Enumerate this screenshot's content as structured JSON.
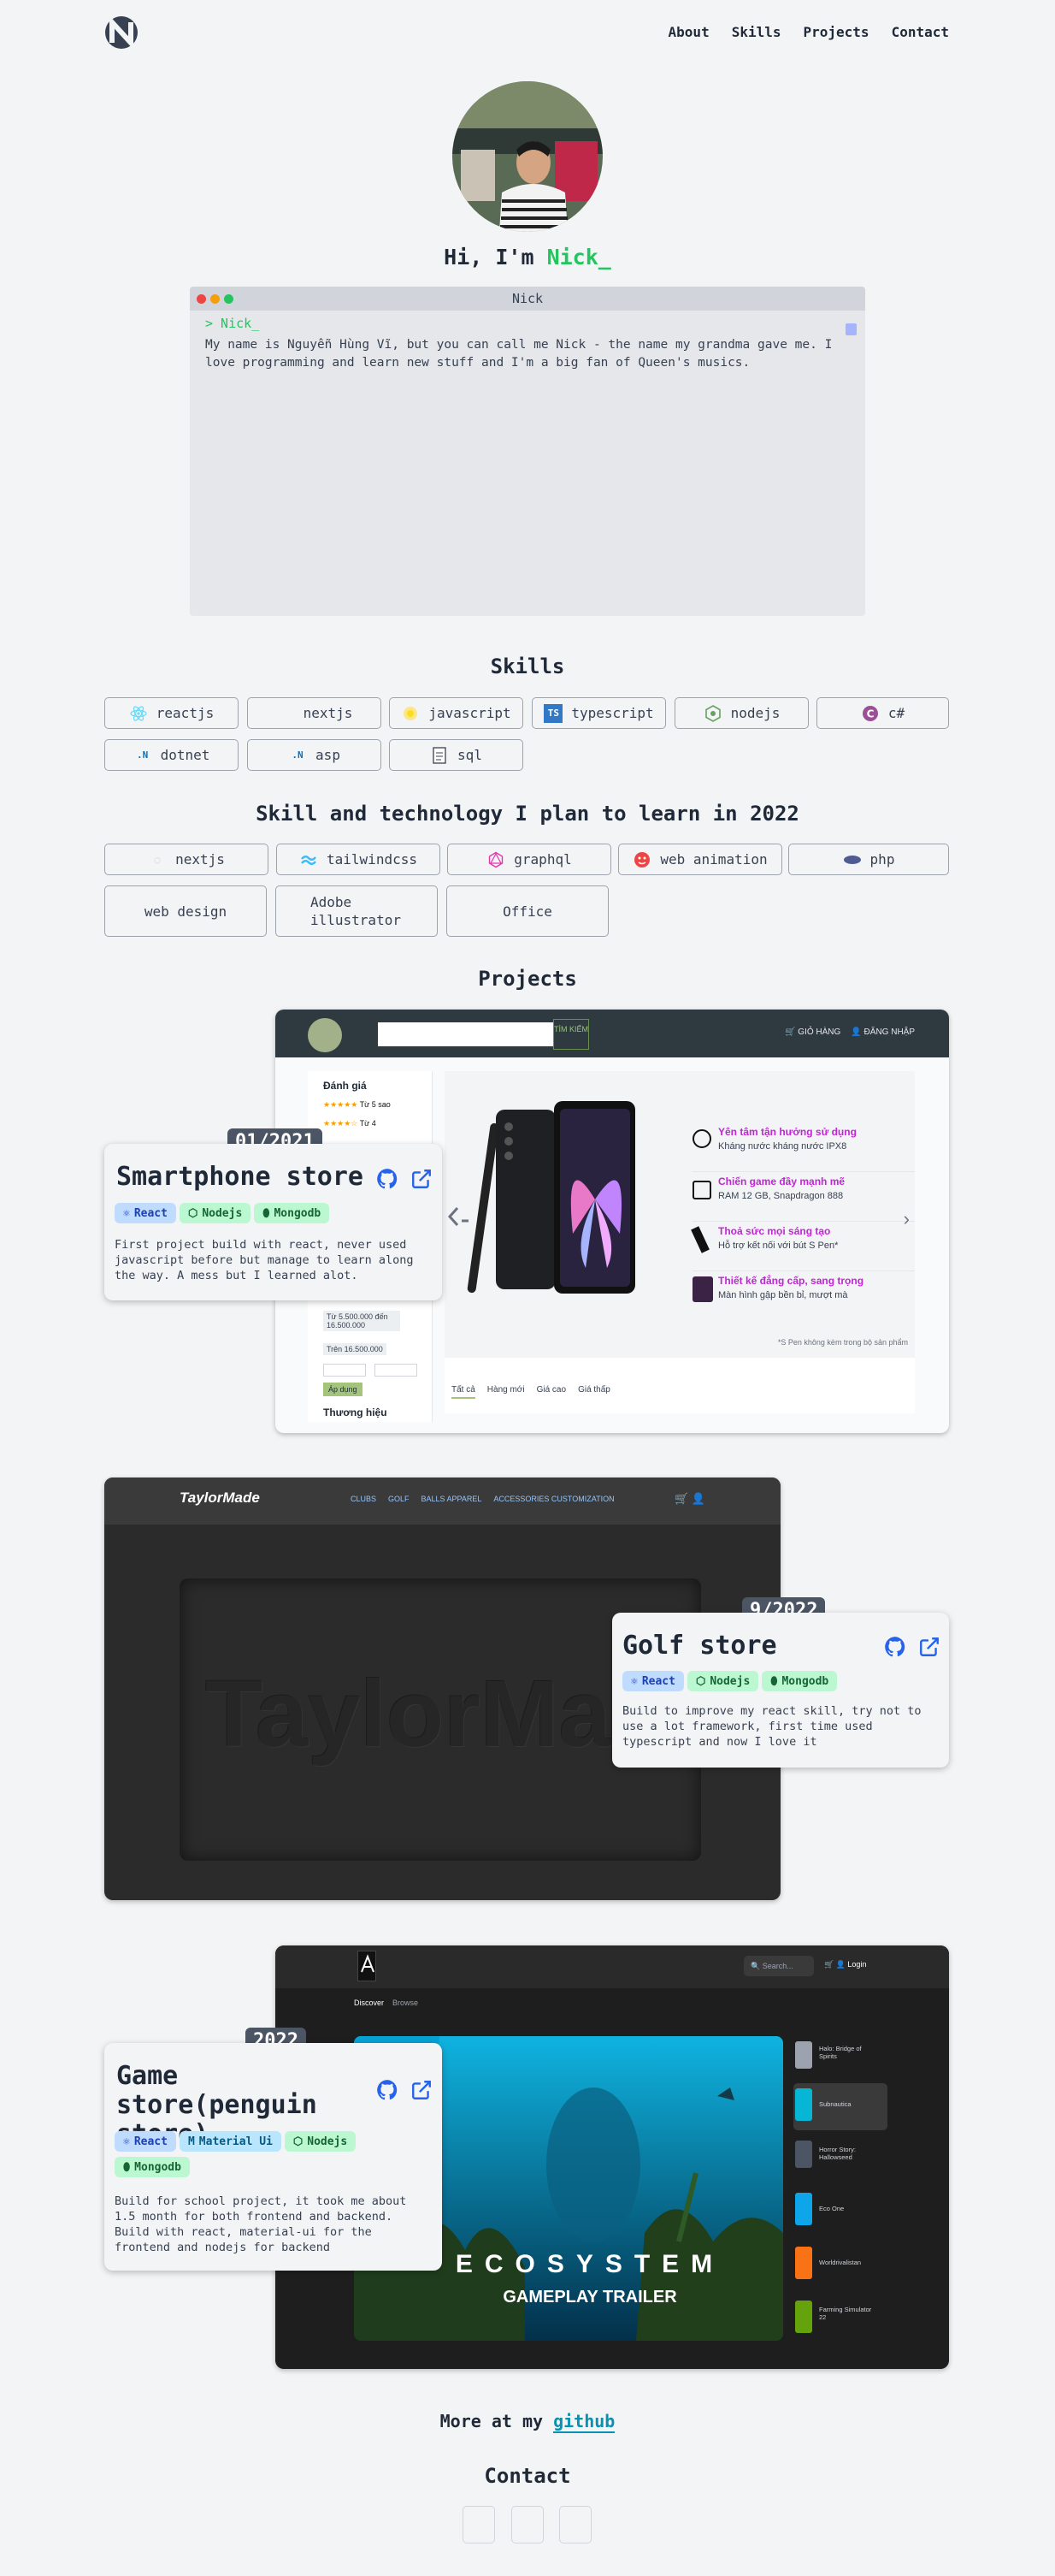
{
  "nav": {
    "links": [
      "About",
      "Skills",
      "Projects",
      "Contact"
    ]
  },
  "hero": {
    "greeting": "Hi, I'm ",
    "name": "Nick_"
  },
  "terminal": {
    "title": "Nick",
    "prompt": "> Nick_",
    "text": "My name is Nguyễn Hùng Vĩ, but you can call me Nick - the name my grandma gave me. I love programming and learn new stuff and I'm a big fan of Queen's musics."
  },
  "skills": {
    "heading": "Skills",
    "items": [
      {
        "label": "reactjs",
        "icon": "react-icon",
        "color": "#61dafb"
      },
      {
        "label": "nextjs",
        "icon": "nextjs-icon",
        "color": "#111111"
      },
      {
        "label": "javascript",
        "icon": "javascript-icon",
        "color": "#f7df1e"
      },
      {
        "label": "typescript",
        "icon": "typescript-icon",
        "color": "#3178c6"
      },
      {
        "label": "nodejs",
        "icon": "nodejs-icon",
        "color": "#68a063"
      },
      {
        "label": "c#",
        "icon": "csharp-icon",
        "color": "#9b4f96"
      },
      {
        "label": "dotnet",
        "icon": "dotnet-icon",
        "color": "#0074c8"
      },
      {
        "label": "asp",
        "icon": "asp-icon",
        "color": "#0074c8"
      },
      {
        "label": "sql",
        "icon": "sql-icon",
        "color": "#374151"
      }
    ]
  },
  "plan": {
    "heading": "Skill and technology I plan to learn in 2022",
    "items": [
      {
        "label": "nextjs",
        "icon": "nextjs-icon"
      },
      {
        "label": "tailwindcss",
        "icon": "tailwind-icon"
      },
      {
        "label": "graphql",
        "icon": "graphql-icon"
      },
      {
        "label": "web animation",
        "icon": "animation-icon"
      },
      {
        "label": "php",
        "icon": "php-icon"
      },
      {
        "label": "web design",
        "icon": ""
      },
      {
        "label": "Adobe illustrator",
        "icon": ""
      },
      {
        "label": "Office",
        "icon": ""
      }
    ]
  },
  "projects": {
    "heading": "Projects",
    "items": [
      {
        "date": "01/2021",
        "title": "Smartphone store",
        "badges": [
          "React",
          "Nodejs",
          "Mongodb"
        ],
        "description": "First project build with react, never used javascript before but manage to learn along the way. A mess but I learned alot.",
        "shot": {
          "search_button": "TÌM KIẾM",
          "cart": "GIỎ HÀNG",
          "login": "ĐĂNG NHẬP",
          "filter_title": "Đánh giá",
          "rating_1": "Từ 5 sao",
          "rating_2": "Từ 4",
          "price_1": "Từ 5.500.000 đến 16.500.000",
          "price_2": "Trên 16.500.000",
          "apply": "Áp dụng",
          "brand": "Thương hiệu",
          "features": [
            {
              "title": "Yên tâm tận hưởng sử dụng",
              "sub": "Kháng nước kháng nước IPX8"
            },
            {
              "title": "Chiến game đầy mạnh mẽ",
              "sub": "RAM 12 GB, Snapdragon 888"
            },
            {
              "title": "Thoả sức mọi sáng tạo",
              "sub": "Hỗ trợ kết nối với bút S Pen*"
            },
            {
              "title": "Thiết kế đẳng cấp, sang trọng",
              "sub": "Màn hình gập bền bỉ, mượt mà"
            }
          ],
          "note": "*S Pen không kèm trong bộ sản phẩm",
          "tabs": [
            "Tất cả",
            "Hàng mới",
            "Giá cao",
            "Giá thấp"
          ]
        }
      },
      {
        "date": "9/2022",
        "title": "Golf store",
        "badges": [
          "React",
          "Nodejs",
          "Mongodb"
        ],
        "description": "Build to improve my react skill, try not to use a lot framework, first time used typescript and now I love it",
        "shot": {
          "brand": "TaylorMade",
          "menu": [
            "CLUBS",
            "GOLF",
            "BALLS APPAREL",
            "ACCESSORIES CUSTOMIZATION"
          ],
          "watermark": "TaylorMade"
        }
      },
      {
        "date": "2022",
        "title": "Game store(penguin store)",
        "badges": [
          "React",
          "Material Ui",
          "Nodejs",
          "Mongodb"
        ],
        "description": "Build for school project, it took me about 1.5 month for both frontend and backend. Build with react, material-ui for the frontend and nodejs for backend",
        "shot": {
          "search": "Search...",
          "login": "Login",
          "tabs": [
            "Discover",
            "Browse"
          ],
          "hero_line1": "ECOSYSTEM",
          "hero_line2": "GAMEPLAY TRAILER",
          "games": [
            "Halo: Bridge of Spirits",
            "Subnautica",
            "Horror Story: Hallowseed",
            "Eco One",
            "Worldrivalistan",
            "Farming Simulator 22"
          ]
        }
      }
    ]
  },
  "footer": {
    "more_prefix": "More at my ",
    "more_link": "github",
    "contact_heading": "Contact"
  }
}
